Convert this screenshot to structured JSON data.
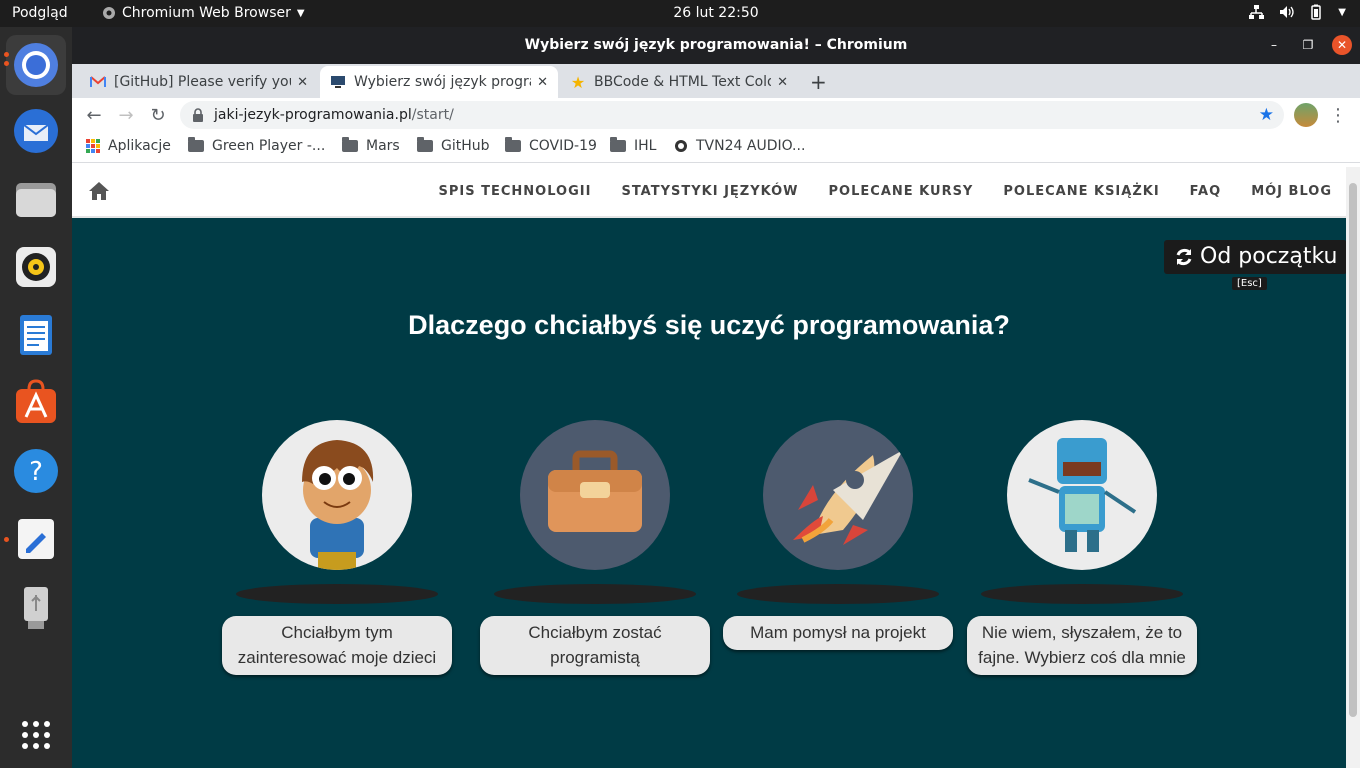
{
  "topbar": {
    "activities": "Podgląd",
    "app_name": "Chromium Web Browser",
    "clock": "26 lut  22:50"
  },
  "dock": {
    "items": [
      "chromium-icon",
      "thunderbird-icon",
      "files-icon",
      "rhythmbox-icon",
      "libreoffice-writer-icon",
      "software-center-icon",
      "help-icon",
      "text-editor-icon",
      "usb-drive-icon",
      "app-grid-icon"
    ]
  },
  "window": {
    "title": "Wybierz swój język programowania! – Chromium"
  },
  "tabs": [
    {
      "title": "[GitHub] Please verify you"
    },
    {
      "title": "Wybierz swój język progra"
    },
    {
      "title": "BBCode & HTML Text Colo"
    }
  ],
  "address": {
    "domain": "jaki-jezyk-programowania.pl",
    "path": "/start/"
  },
  "bookmarks": [
    "Aplikacje",
    "Green Player -...",
    "Mars",
    "GitHub",
    "COVID-19",
    "IHL",
    "TVN24 AUDIO..."
  ],
  "site": {
    "nav": [
      "SPIS TECHNOLOGII",
      "STATYSTYKI JĘZYKÓW",
      "POLECANE KURSY",
      "POLECANE KSIĄŻKI",
      "FAQ",
      "MÓJ BLOG"
    ],
    "restart_label": "Od początku",
    "restart_hint": "[Esc]",
    "question": "Dlaczego chciałbyś się uczyć programowania?",
    "options": [
      {
        "label": "Chciałbym tym zainteresować moje dzieci"
      },
      {
        "label": "Chciałbym zostać programistą"
      },
      {
        "label": "Mam pomysł na projekt"
      },
      {
        "label": "Nie wiem, słyszałem, że to fajne. Wybierz coś dla mnie"
      }
    ]
  },
  "colors": {
    "page_bg": "#003b45",
    "accent": "#e9542a"
  }
}
